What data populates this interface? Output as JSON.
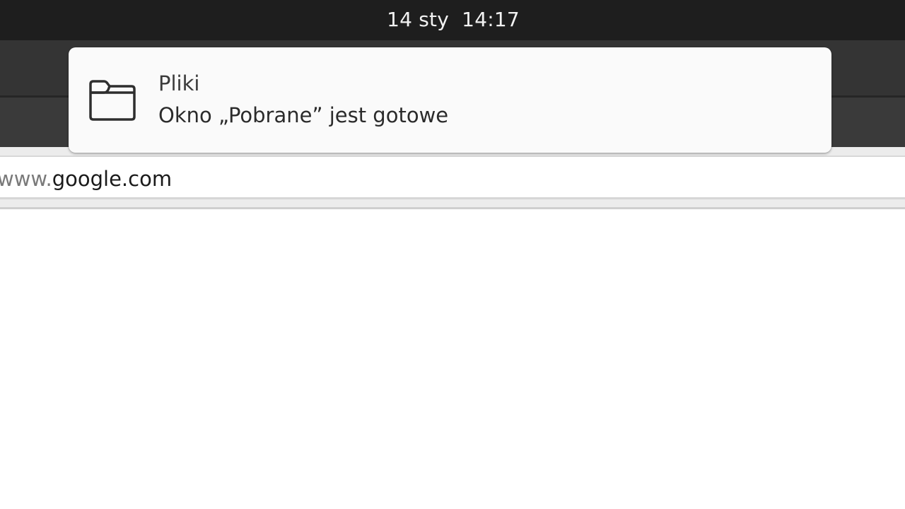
{
  "top_bar": {
    "clock": "14 sty  14:17"
  },
  "browser": {
    "url_prefix": "www.",
    "url_domain": "google.com"
  },
  "notification": {
    "icon": "folder-icon",
    "app_name": "Pliki",
    "message": "Okno „Pobrane” jest gotowe"
  },
  "colors": {
    "top_bar": "#1e1e1e",
    "notification_bg": "#fafafa",
    "page_bg": "#ffffff"
  }
}
